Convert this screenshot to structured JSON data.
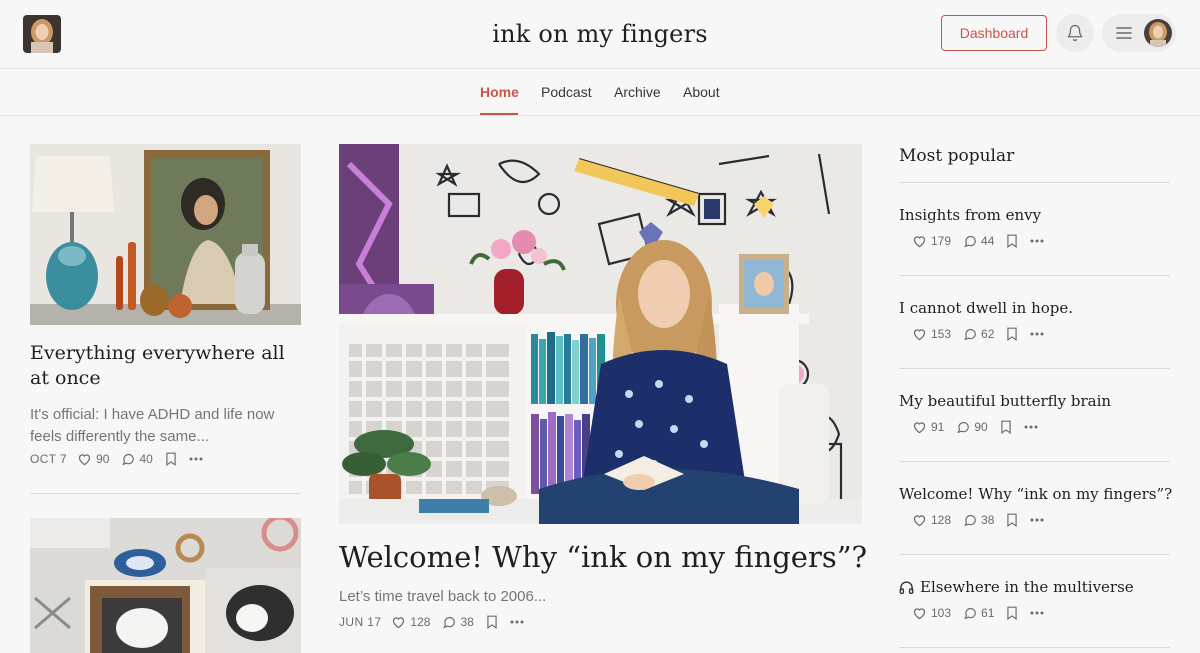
{
  "header": {
    "site_title": "ink on my fingers",
    "dashboard_label": "Dashboard"
  },
  "nav": {
    "items": [
      {
        "label": "Home",
        "active": true
      },
      {
        "label": "Podcast",
        "active": false
      },
      {
        "label": "Archive",
        "active": false
      },
      {
        "label": "About",
        "active": false
      }
    ]
  },
  "left_posts": [
    {
      "title": "Everything everywhere all at once",
      "subtitle": "It's official: I have ADHD and life now feels differently the same...",
      "date": "OCT 7",
      "likes": "90",
      "comments": "40"
    }
  ],
  "featured": {
    "title": "Welcome! Why “ink on my fingers”?",
    "subtitle": "Let’s time travel back to 2006...",
    "date": "JUN 17",
    "likes": "128",
    "comments": "38"
  },
  "most_popular": {
    "heading": "Most popular",
    "items": [
      {
        "title": "Insights from envy",
        "likes": "179",
        "comments": "44",
        "podcast": false
      },
      {
        "title": "I cannot dwell in hope.",
        "likes": "153",
        "comments": "62",
        "podcast": false
      },
      {
        "title": "My beautiful butterfly brain",
        "likes": "91",
        "comments": "90",
        "podcast": false
      },
      {
        "title": "Welcome! Why “ink on my fingers”?",
        "likes": "128",
        "comments": "38",
        "podcast": false
      },
      {
        "title": "Elsewhere in the multiverse",
        "likes": "103",
        "comments": "61",
        "podcast": true
      }
    ]
  },
  "colors": {
    "accent": "#c9544b",
    "background": "#f7f7f7",
    "text": "#1f1f1f",
    "muted": "#757575"
  },
  "icons": [
    "heart-icon",
    "comment-icon",
    "bookmark-icon",
    "more-icon",
    "bell-icon",
    "menu-icon",
    "headphones-icon"
  ]
}
